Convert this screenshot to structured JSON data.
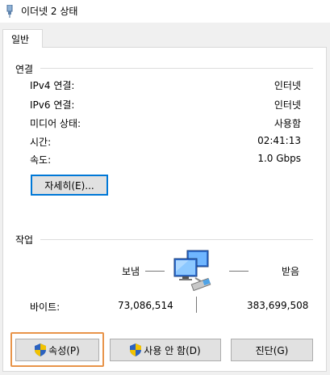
{
  "window": {
    "title": "이더넷 2 상태"
  },
  "tabs": [
    {
      "label": "일반"
    }
  ],
  "connection": {
    "heading": "연결",
    "rows": [
      {
        "label": "IPv4 연결:",
        "value": "인터넷"
      },
      {
        "label": "IPv6 연결:",
        "value": "인터넷"
      },
      {
        "label": "미디어 상태:",
        "value": "사용함"
      },
      {
        "label": "시간:",
        "value": "02:41:13"
      },
      {
        "label": "속도:",
        "value": "1.0 Gbps"
      }
    ],
    "details_button": "자세히(E)..."
  },
  "activity": {
    "heading": "작업",
    "sent_label": "보냄",
    "received_label": "받음",
    "bytes_label": "바이트:",
    "bytes_sent": "73,086,514",
    "bytes_received": "383,699,508"
  },
  "buttons": {
    "properties": "속성(P)",
    "disable": "사용 안 함(D)",
    "diagnose": "진단(G)"
  }
}
